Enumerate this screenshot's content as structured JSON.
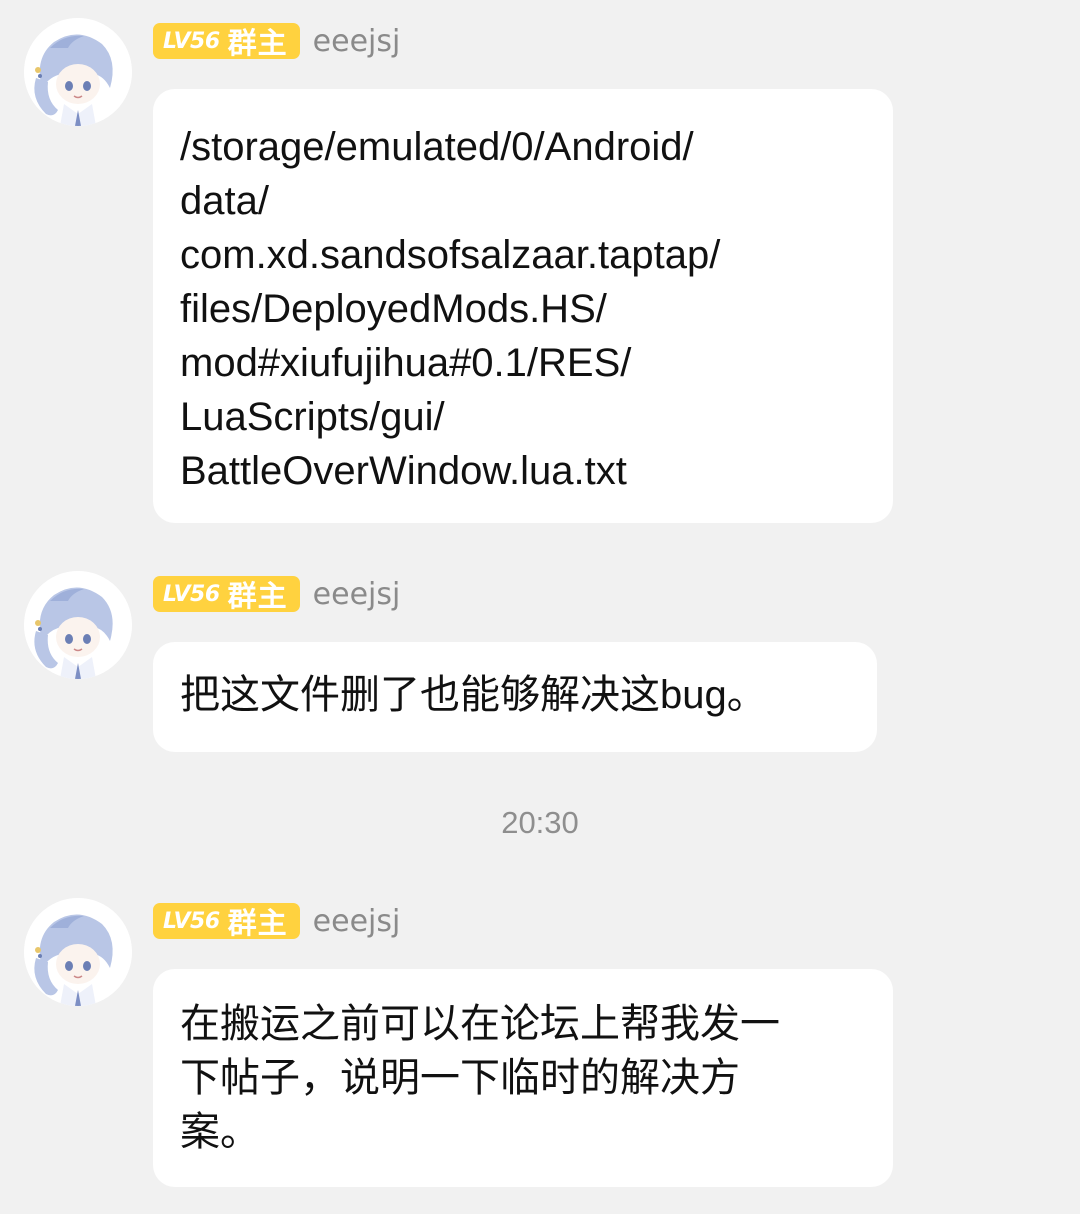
{
  "messages": [
    {
      "badge_level": "LV56",
      "badge_role": "群主",
      "username": "eeejsj",
      "lines": [
        "/storage/emulated/0/Android/",
        "data/",
        "com.xd.sandsofsalzaar.taptap/",
        "files/DeployedMods.HS/",
        "mod#xiufujihua#0.1/RES/",
        "LuaScripts/gui/",
        "BattleOverWindow.lua.txt"
      ]
    },
    {
      "badge_level": "LV56",
      "badge_role": "群主",
      "username": "eeejsj",
      "lines": [
        "把这文件删了也能够解决这bug。"
      ]
    },
    {
      "badge_level": "LV56",
      "badge_role": "群主",
      "username": "eeejsj",
      "lines": [
        "在搬运之前可以在论坛上帮我发一",
        "下帖子，说明一下临时的解决方",
        "案。"
      ]
    }
  ],
  "timestamp": "20:30",
  "colors": {
    "background": "#f1f1f1",
    "bubble": "#ffffff",
    "badge": "#ffd23f",
    "username": "#8a8a8a",
    "text": "#111111"
  },
  "icons": {
    "avatar": "anime-avatar-icon"
  }
}
